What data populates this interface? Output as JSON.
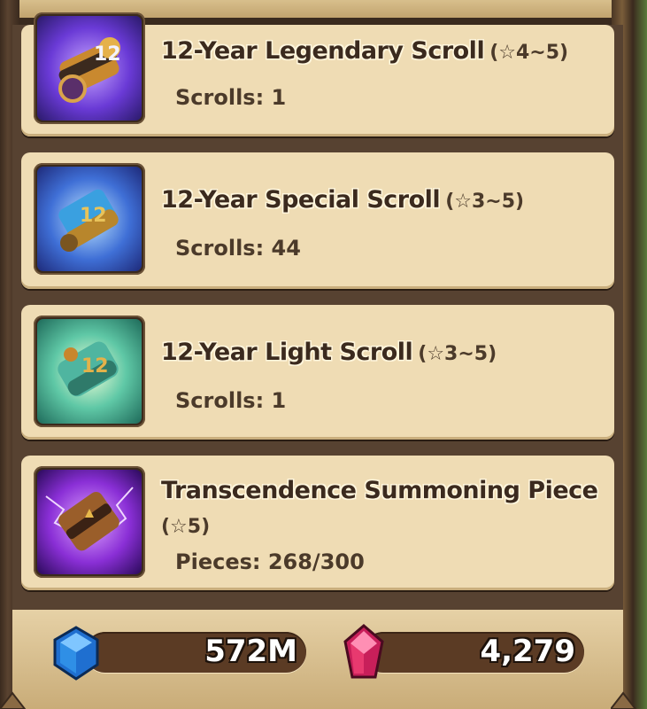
{
  "items": [
    {
      "title": "12-Year Legendary Scroll",
      "stars": "(☆4~5)",
      "count_text": "Scrolls: 1",
      "icon": "legendary-scroll-icon"
    },
    {
      "title": "12-Year Special Scroll",
      "stars": "(☆3~5)",
      "count_text": "Scrolls: 44",
      "icon": "special-scroll-icon"
    },
    {
      "title": "12-Year Light Scroll",
      "stars": "(☆3~5)",
      "count_text": "Scrolls: 1",
      "icon": "light-scroll-icon"
    },
    {
      "title": "Transcendence Summoning Piece",
      "stars": "(☆5)",
      "count_text": "Pieces: 268/300",
      "icon": "transcendence-piece-icon"
    }
  ],
  "currencies": {
    "mana": {
      "value": "572M",
      "icon": "blue-crystal-icon",
      "color": "#2f8fe6"
    },
    "crystal": {
      "value": "4,279",
      "icon": "red-crystal-icon",
      "color": "#e8396f"
    }
  },
  "colors": {
    "card_bg": "#efdcb4",
    "frame_dark": "#574231",
    "text_dark": "#3b2a1e"
  }
}
